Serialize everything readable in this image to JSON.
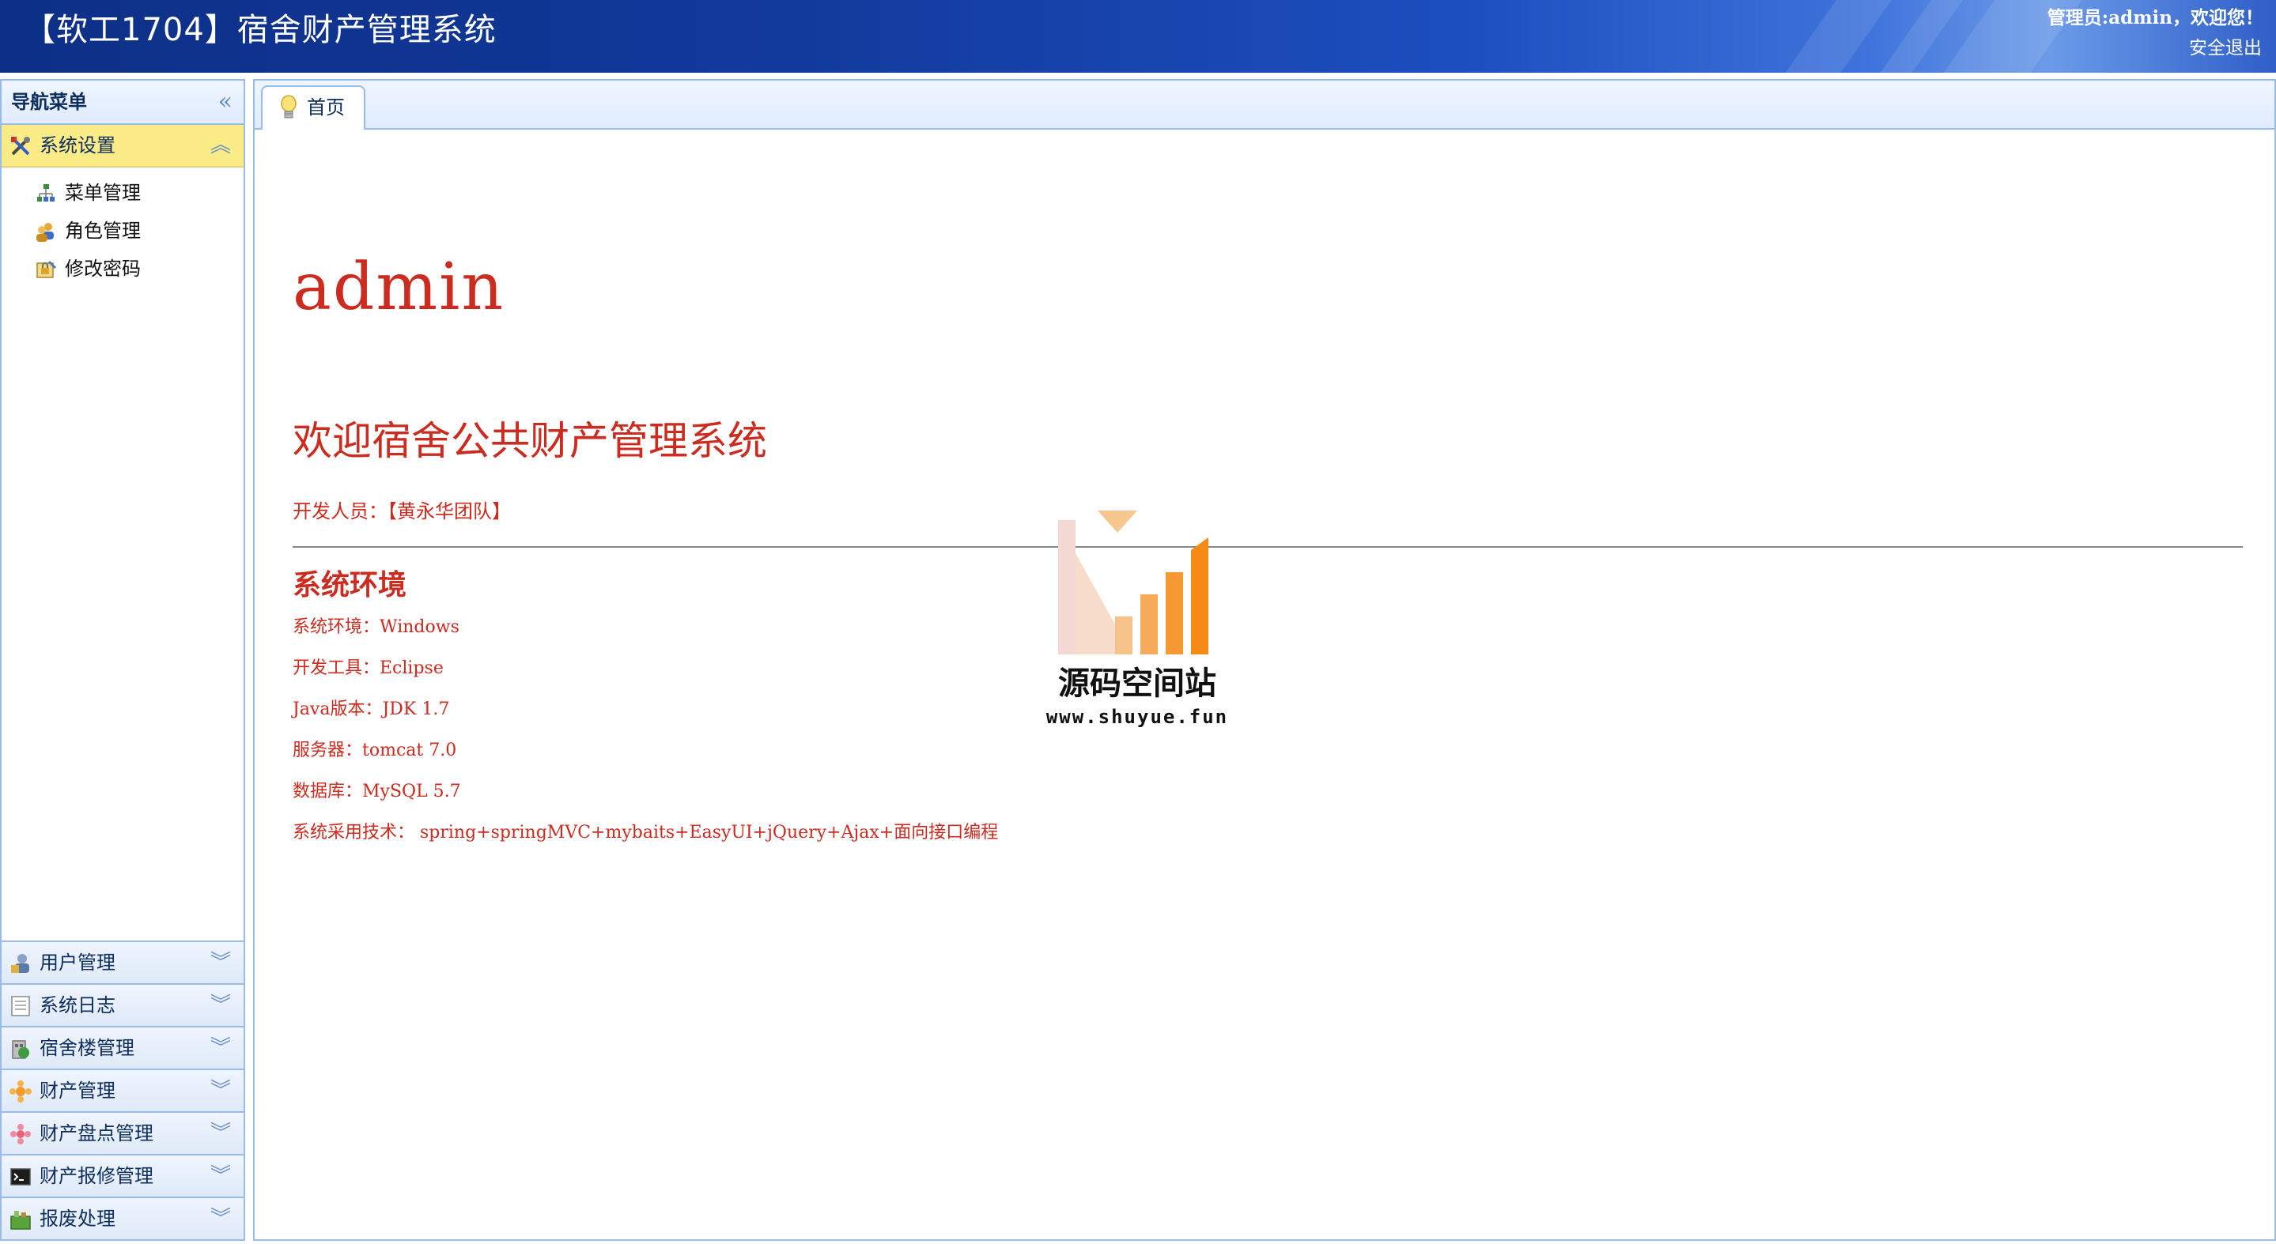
{
  "header": {
    "title": "【软工1704】宿舍财产管理系统",
    "welcome": "管理员:admin，欢迎您！",
    "logout": "安全退出"
  },
  "nav": {
    "title": "导航菜单",
    "collapse_icon": "double-chevron-left-icon",
    "active_panel": {
      "label": "系统设置",
      "icon": "tools-icon",
      "items": [
        {
          "label": "菜单管理",
          "icon": "tree-icon"
        },
        {
          "label": "角色管理",
          "icon": "users-icon"
        },
        {
          "label": "修改密码",
          "icon": "lock-edit-icon"
        }
      ]
    },
    "panels": [
      {
        "label": "用户管理",
        "icon": "user-icon"
      },
      {
        "label": "系统日志",
        "icon": "log-icon"
      },
      {
        "label": "宿舍楼管理",
        "icon": "building-icon"
      },
      {
        "label": "财产管理",
        "icon": "asset-icon"
      },
      {
        "label": "财产盘点管理",
        "icon": "inventory-icon"
      },
      {
        "label": "财产报修管理",
        "icon": "terminal-icon"
      },
      {
        "label": "报废处理",
        "icon": "scrap-icon"
      }
    ]
  },
  "tabs": [
    {
      "label": "首页",
      "icon": "bulb-icon"
    }
  ],
  "content": {
    "admin": "admin",
    "welcome": "欢迎宿舍公共财产管理系统",
    "developer": "开发人员：【黄永华团队】",
    "env_title": "系统环境",
    "env_lines": [
      "系统环境：Windows",
      "开发工具：Eclipse",
      "Java版本：JDK 1.7",
      "服务器：tomcat 7.0",
      "数据库：MySQL 5.7",
      "系统采用技术： spring+springMVC+mybaits+EasyUI+jQuery+Ajax+面向接口编程"
    ]
  },
  "watermark": {
    "name": "源码空间站",
    "url": "www.shuyue.fun"
  },
  "colors": {
    "header_blue": "#123a9c",
    "nav_border": "#99bbe8",
    "active_panel": "#fbec88",
    "content_red": "#cc2b1f",
    "watermark_orange": "#f58a14"
  }
}
